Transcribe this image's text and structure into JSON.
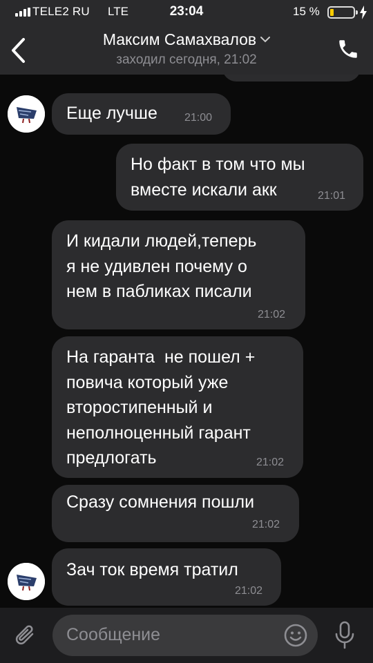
{
  "status_bar": {
    "carrier": "TELE2 RU",
    "network": "LTE",
    "time": "23:04",
    "battery_percent": "15 %",
    "battery_level": 0.15,
    "battery_color": "#ffcc00"
  },
  "header": {
    "contact_name": "Максим Самахвалов",
    "last_seen": "заходил сегодня, 21:02",
    "back_icon": "chevron-left-icon",
    "call_icon": "phone-icon",
    "expand_icon": "chevron-down-icon"
  },
  "messages": [
    {
      "direction": "incoming",
      "text": "Еще лучше",
      "time": "21:00",
      "avatar": true
    },
    {
      "direction": "outgoing",
      "text": "Но факт в том что мы\nвместе искали акк",
      "time": "21:01"
    },
    {
      "direction": "incoming",
      "text": "И кидали людей,теперь\nя не удивлен почему о\nнем в пабликах писали",
      "time": "21:02"
    },
    {
      "direction": "incoming",
      "text": "На гаранта  не пошел +\nповича который уже\nвторостипенный и\nнеполноценный гарант\nпредлогать",
      "time": "21:02"
    },
    {
      "direction": "incoming",
      "text": "Сразу сомнения пошли",
      "time": "21:02"
    },
    {
      "direction": "incoming",
      "text": "Зач ток время тратил",
      "time": "21:02",
      "avatar": true
    }
  ],
  "input": {
    "placeholder": "Сообщение",
    "attach_icon": "paperclip-icon",
    "emoji_icon": "smile-icon",
    "voice_icon": "microphone-icon"
  },
  "colors": {
    "background": "#0a0a0a",
    "bar": "#2a2a2c",
    "bubble": "#2c2c2e",
    "secondary_text": "#8e8e93",
    "input_field": "#3a3a3c"
  }
}
